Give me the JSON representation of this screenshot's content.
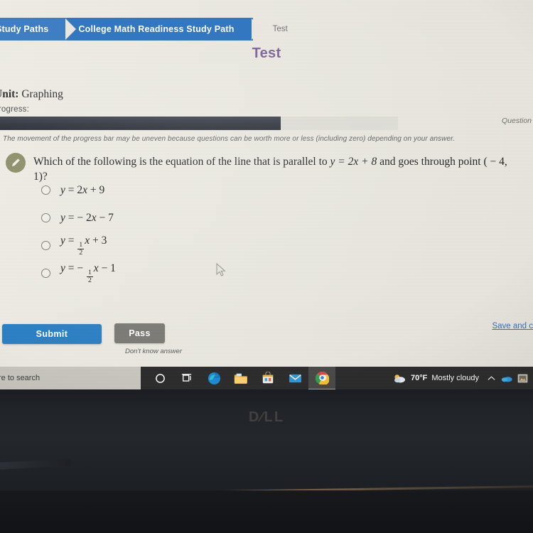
{
  "breadcrumb": {
    "items": [
      {
        "label": "Study Paths",
        "style": "active"
      },
      {
        "label": "College Math Readiness Study Path",
        "style": "active"
      },
      {
        "label": "Test",
        "style": "plain"
      }
    ]
  },
  "header": {
    "title": "Test"
  },
  "unit": {
    "prefix": "Unit:",
    "name": "Graphing"
  },
  "progress": {
    "label": "Progress:",
    "percent": 71,
    "counter": "Question",
    "note": "The movement of the progress bar may be uneven because questions can be worth more or less (including zero) depending on your answer."
  },
  "question": {
    "icon": "pencil-icon",
    "text_part1": "Which of the following is the equation of the line that is parallel to ",
    "equation": "y = 2x + 8",
    "text_part2": " and goes through point ( − 4, 1)?",
    "options": [
      {
        "id": "a",
        "text": "y = 2x + 9",
        "selected": false
      },
      {
        "id": "b",
        "text": "y = − 2x − 7",
        "selected": false
      },
      {
        "id": "c",
        "text": "y = ½x + 3",
        "selected": false
      },
      {
        "id": "d",
        "text": "y = − ½x − 1",
        "selected": false
      }
    ]
  },
  "actions": {
    "submit_label": "Submit",
    "pass_label": "Pass",
    "pass_caption": "Don't know answer",
    "save_link_label": "Save and c"
  },
  "taskbar": {
    "search_placeholder": "re to search",
    "icons": [
      {
        "name": "cortana-icon",
        "glyph": "○"
      },
      {
        "name": "task-view-icon",
        "glyph": "☰"
      },
      {
        "name": "edge-icon",
        "glyph": "e"
      },
      {
        "name": "file-explorer-icon",
        "glyph": "▤"
      },
      {
        "name": "microsoft-store-icon",
        "glyph": "▣"
      },
      {
        "name": "mail-icon",
        "glyph": "✉"
      },
      {
        "name": "chrome-icon",
        "glyph": "◉"
      }
    ],
    "weather": {
      "temperature": "70°F",
      "condition": "Mostly cloudy"
    },
    "tray": [
      {
        "name": "show-hidden-icons-chevron",
        "glyph": "⌃"
      },
      {
        "name": "onedrive-icon",
        "glyph": "☁"
      },
      {
        "name": "tray-app-icon",
        "glyph": "▦"
      }
    ]
  },
  "device": {
    "brand": "D∕LL"
  },
  "colors": {
    "breadcrumb_blue": "#3f7ec2",
    "title_purple": "#7b5f96",
    "submit_blue": "#2b80c4",
    "pass_gray": "#7b7a74",
    "link_blue": "#3b6fb0",
    "pencil_badge": "#8c8d68",
    "progress_fill": "#2e333c"
  }
}
